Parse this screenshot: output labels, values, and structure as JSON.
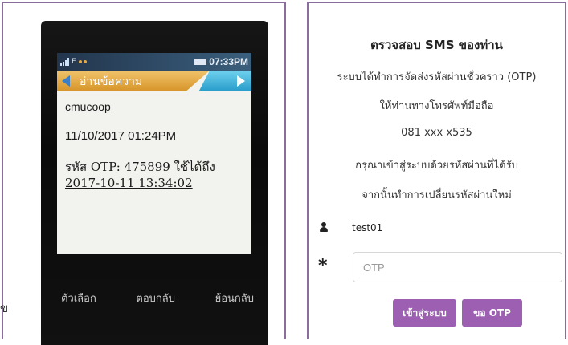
{
  "phone": {
    "status_time": "07:33PM",
    "title": "อ่านข้อความ",
    "sender": "cmucoop",
    "datetime": "11/10/2017 01:24PM",
    "body_line1": "รหัส OTP: 475899 ใช้ได้ถึง",
    "body_line2": "2017-10-11 13:34:02",
    "softkey_left": "ตัวเลือก",
    "softkey_center": "ตอบกลับ",
    "softkey_right": "ย้อนกลับ"
  },
  "stray_text": "ข",
  "form": {
    "title": "ตรวจสอบ SMS ของท่าน",
    "lines": [
      "ระบบได้ทำการจัดส่งรหัสผ่านชั่วคราว (OTP)",
      "ให้ท่านทางโทรศัพท์มือถือ",
      "081 xxx x535",
      "กรุณาเข้าสู่ระบบด้วยรหัสผ่านที่ได้รับ",
      "จากนั้นทำการเปลี่ยนรหัสผ่านใหม่"
    ],
    "username": "test01",
    "required_mark": "*",
    "otp_placeholder": "OTP",
    "otp_value": "",
    "login_button": "เข้าสู่ระบบ",
    "request_otp_button": "ขอ OTP"
  },
  "colors": {
    "frame_border": "#8a6d9c",
    "button_bg": "#9c5fb1",
    "phone_title_orange": "#d8962b",
    "phone_title_blue": "#2a9ecb"
  }
}
